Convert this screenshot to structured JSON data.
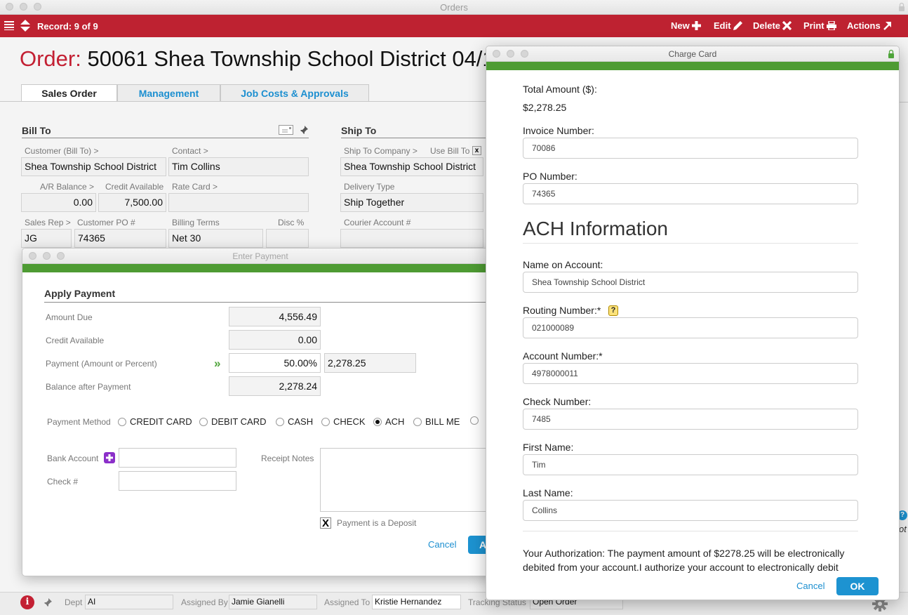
{
  "window": {
    "title": "Orders"
  },
  "toolbar": {
    "record_label": "Record: 9 of 9",
    "buttons": [
      {
        "label": "New",
        "icon": "plus-icon"
      },
      {
        "label": "Edit",
        "icon": "pencil-icon"
      },
      {
        "label": "Delete",
        "icon": "x-icon"
      },
      {
        "label": "Print",
        "icon": "printer-icon"
      },
      {
        "label": "Actions",
        "icon": "arrow-up-right-icon"
      }
    ]
  },
  "order": {
    "label": "Order:",
    "title": "50061 Shea Township School District  04/1"
  },
  "tabs": [
    {
      "label": "Sales Order",
      "active": true
    },
    {
      "label": "Management",
      "active": false
    },
    {
      "label": "Job Costs & Approvals",
      "active": false
    }
  ],
  "bill_to": {
    "heading": "Bill To",
    "customer_label": "Customer (Bill To) >",
    "customer_value": "Shea Township School District",
    "contact_label": "Contact >",
    "contact_value": "Tim Collins",
    "ar_balance_label": "A/R Balance >",
    "ar_balance_value": "0.00",
    "credit_label": "Credit Available",
    "credit_value": "7,500.00",
    "rate_card_label": "Rate Card >",
    "rate_card_value": "",
    "sales_rep_label": "Sales Rep >",
    "sales_rep_value": "JG",
    "customer_po_label": "Customer PO #",
    "customer_po_value": "74365",
    "billing_terms_label": "Billing Terms",
    "billing_terms_value": "Net 30",
    "disc_label": "Disc %",
    "disc_value": ""
  },
  "ship_to": {
    "heading": "Ship To",
    "company_label": "Ship To Company >",
    "use_bill_to_label": "Use Bill To",
    "use_bill_to_mark": "x",
    "company_value": "Shea Township School District",
    "delivery_type_label": "Delivery Type",
    "delivery_type_value": "Ship Together",
    "courier_label": "Courier Account #",
    "courier_value": ""
  },
  "status_bar": {
    "dept_label": "Dept",
    "dept_value": "AI",
    "assigned_by_label": "Assigned By",
    "assigned_by_value": "Jamie Gianelli",
    "assigned_to_label": "Assigned To",
    "assigned_to_value": "Kristie Hernandez",
    "tracking_label": "Tracking Status",
    "tracking_value": "Open Order"
  },
  "enter_payment": {
    "title": "Enter Payment",
    "section": "Apply Payment",
    "amount_due_label": "Amount Due",
    "amount_due_value": "4,556.49",
    "credit_available_label": "Credit Available",
    "credit_available_value": "0.00",
    "payment_label": "Payment (Amount or Percent)",
    "payment_percent": "50.00%",
    "payment_amount": "2,278.25",
    "balance_label": "Balance after Payment",
    "balance_value": "2,278.24",
    "payment_method_label": "Payment Method",
    "methods": [
      {
        "label": "CREDIT CARD",
        "selected": false
      },
      {
        "label": "DEBIT CARD",
        "selected": false
      },
      {
        "label": "CASH",
        "selected": false
      },
      {
        "label": "CHECK",
        "selected": false
      },
      {
        "label": "ACH",
        "selected": true
      },
      {
        "label": "BILL ME",
        "selected": false
      },
      {
        "label": "",
        "selected": false
      }
    ],
    "bank_account_label": "Bank Account",
    "bank_account_value": "",
    "check_label": "Check #",
    "check_value": "",
    "receipt_notes_label": "Receipt Notes",
    "receipt_notes_value": "",
    "deposit_label": "Payment is a Deposit",
    "deposit_checked": true,
    "deposit_mark": "X",
    "cancel_label": "Cancel",
    "apply_label": "A"
  },
  "charge_card": {
    "title": "Charge Card",
    "total_label": "Total Amount ($):",
    "total_value": "$2,278.25",
    "invoice_label": "Invoice Number:",
    "invoice_value": "70086",
    "po_label": "PO Number:",
    "po_value": "74365",
    "ach_heading": "ACH Information",
    "name_label": "Name on Account:",
    "name_value": "Shea Township School District",
    "routing_label": "Routing Number:*",
    "routing_help": "?",
    "routing_value": "021000089",
    "account_label": "Account Number:*",
    "account_value": "4978000011",
    "check_label": "Check Number:",
    "check_value": "7485",
    "first_name_label": "First Name:",
    "first_name_value": "Tim",
    "last_name_label": "Last Name:",
    "last_name_value": "Collins",
    "authorization_text": "Your Authorization: The payment amount of $2278.25 will be electronically debited from your account.I authorize your account to electronically debit",
    "cancel_label": "Cancel",
    "ok_label": "OK"
  },
  "background_fragments": {
    "help_partial_text": "ot"
  },
  "colors": {
    "brand_red": "#be2231",
    "green_bar": "#4e9b33",
    "primary_blue": "#1d93d1",
    "link_blue": "#1c8fd0",
    "purple_add": "#8b2fc9"
  }
}
